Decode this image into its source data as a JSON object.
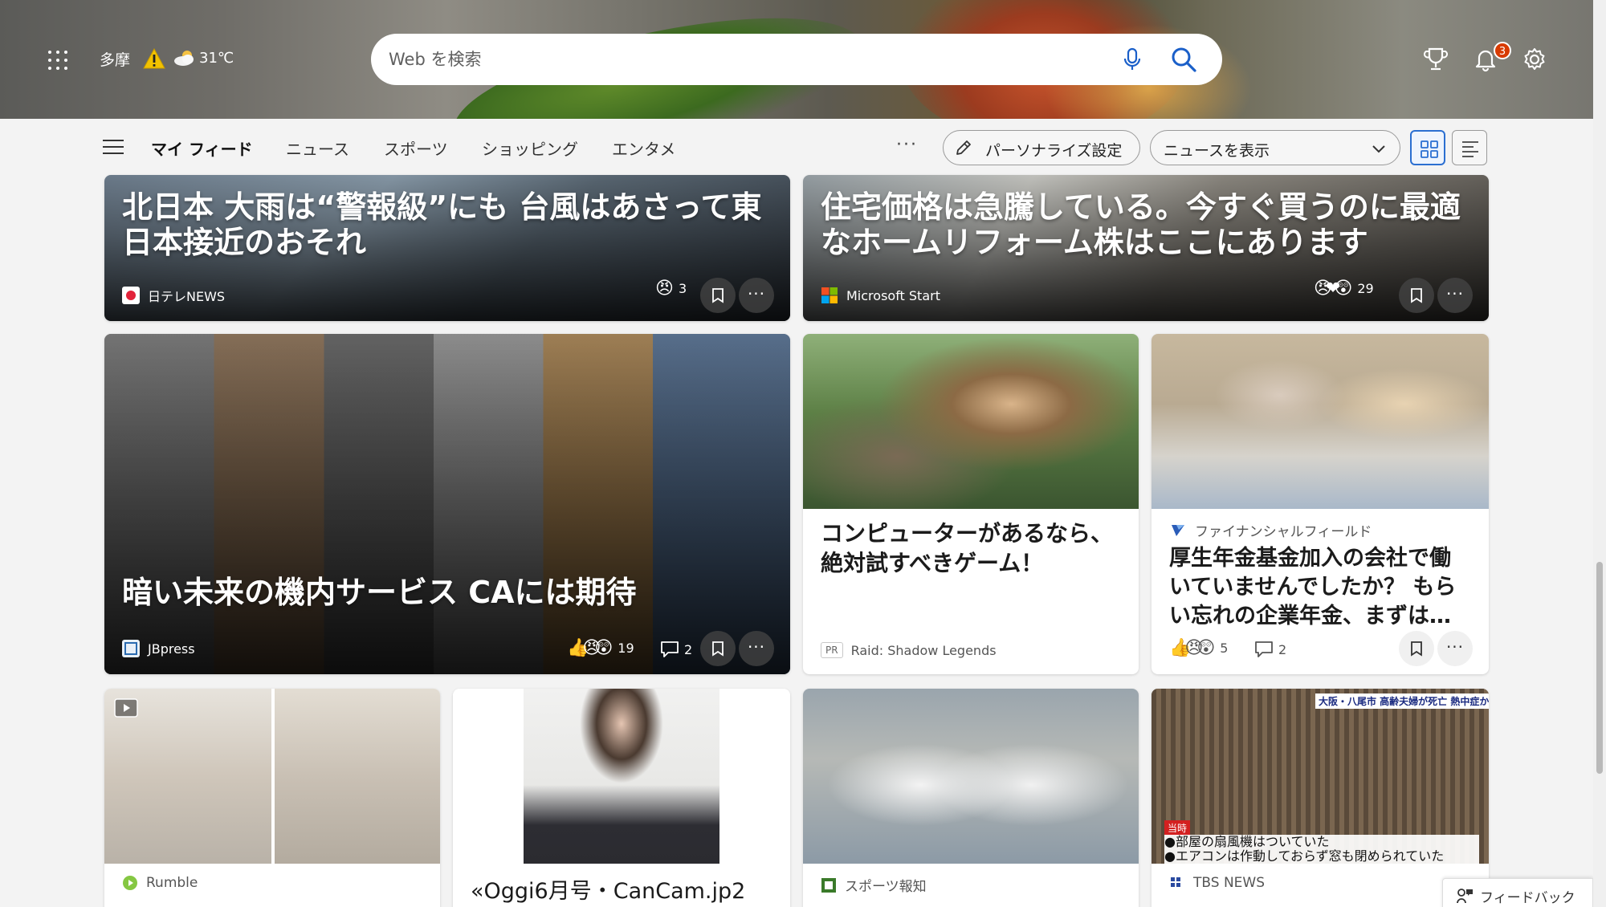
{
  "header": {
    "location": "多摩",
    "temperature": "31℃",
    "search": {
      "placeholder": "Web を検索"
    },
    "notification_count": "3"
  },
  "nav": {
    "tabs": [
      {
        "label": "マイ フィード",
        "active": true
      },
      {
        "label": "ニュース"
      },
      {
        "label": "スポーツ"
      },
      {
        "label": "ショッピング"
      },
      {
        "label": "エンタメ"
      }
    ],
    "more": "···",
    "personalize_label": "パーソナライズ設定",
    "view_select_value": "ニュースを表示"
  },
  "cards": {
    "top_left": {
      "title": "北日本 大雨は“警報級”にも 台風はあさって東日本接近のおそれ",
      "publisher": "日テレNEWS",
      "reaction_count": "3"
    },
    "top_right": {
      "title": "住宅価格は急騰している。今すぐ買うのに最適なホームリフォーム株はここにあります",
      "publisher": "Microsoft Start",
      "reaction_count": "29"
    },
    "mid_large": {
      "title": "暗い未来の機内サービス CAには期待",
      "publisher": "JBpress",
      "reaction_count": "19",
      "comment_count": "2"
    },
    "game_ad": {
      "title": "コンピューターがあるなら、絶対試すべきゲーム！",
      "pr": "PR",
      "sponsor": "Raid: Shadow Legends"
    },
    "pension": {
      "publisher": "ファイナンシャルフィールド",
      "title": "厚生年金基金加入の会社で働いていませんでしたか？ もらい忘れの企業年金、まずは…",
      "reaction_count": "5",
      "comment_count": "2"
    },
    "rumble": {
      "publisher": "Rumble"
    },
    "oggi": {
      "title": "«Oggi6月号・CanCam.jp2"
    },
    "sports_hochi": {
      "publisher": "スポーツ報知"
    },
    "tbs": {
      "publisher": "TBS NEWS",
      "caption_top": "大阪・八尾市 高齢夫婦が死亡 熱中症か",
      "badge": "当時",
      "caption_line1": "●部屋の扇風機はついていた",
      "caption_line2": "●エアコンは作動しておらず窓も閉められていた"
    }
  },
  "feedback_label": "フィードバック",
  "colors": {
    "accent": "#2b6fd1",
    "badge": "#d83b01",
    "background": "#f3f3f3"
  }
}
